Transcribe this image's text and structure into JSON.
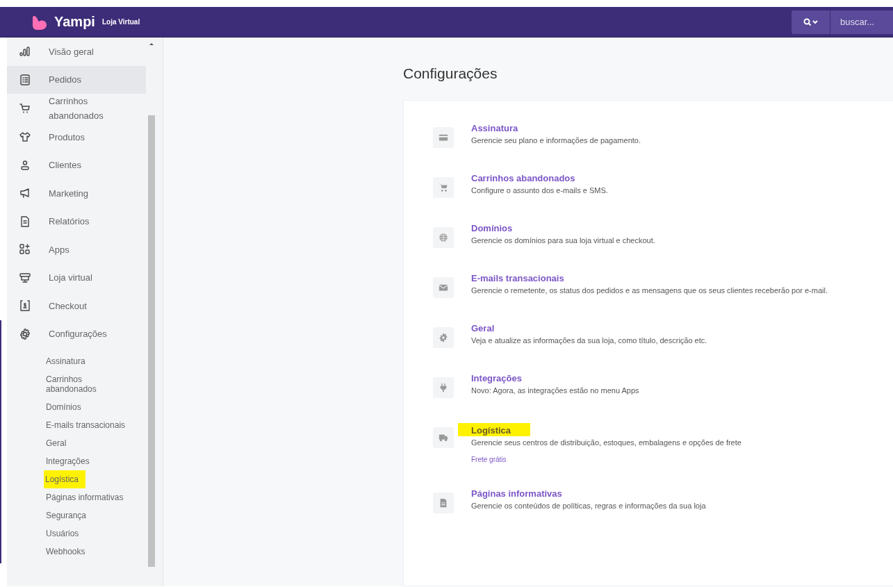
{
  "header": {
    "brand": "Yampi",
    "subtitle": "Loja Virtual",
    "search_placeholder": "buscar..."
  },
  "sidebar": {
    "items": [
      {
        "label": "Visão geral",
        "kind": "chart",
        "selected": false
      },
      {
        "label": "Pedidos",
        "kind": "list",
        "selected": true
      },
      {
        "label": "Carrinhos abandonados",
        "kind": "cart",
        "selected": false
      },
      {
        "label": "Produtos",
        "kind": "shirt",
        "selected": false
      },
      {
        "label": "Clientes",
        "kind": "user",
        "selected": false
      },
      {
        "label": "Marketing",
        "kind": "megaphone",
        "selected": false
      },
      {
        "label": "Relatórios",
        "kind": "doc",
        "selected": false
      },
      {
        "label": "Apps",
        "kind": "apps",
        "selected": false
      },
      {
        "label": "Loja virtual",
        "kind": "store",
        "selected": false
      },
      {
        "label": "Checkout",
        "kind": "dollar",
        "selected": false
      },
      {
        "label": "Configurações",
        "kind": "gear",
        "selected": false,
        "expanded": true,
        "children": [
          {
            "label": "Assinatura",
            "highlighted": false
          },
          {
            "label": "Carrinhos abandonados",
            "highlighted": false
          },
          {
            "label": "Domínios",
            "highlighted": false
          },
          {
            "label": "E-mails transacionais",
            "highlighted": false
          },
          {
            "label": "Geral",
            "highlighted": false
          },
          {
            "label": "Integrações",
            "highlighted": false
          },
          {
            "label": "Logística",
            "highlighted": true
          },
          {
            "label": "Páginas informativas",
            "highlighted": false
          },
          {
            "label": "Segurança",
            "highlighted": false
          },
          {
            "label": "Usuários",
            "highlighted": false
          },
          {
            "label": "Webhooks",
            "highlighted": false
          }
        ]
      }
    ]
  },
  "page": {
    "title": "Configurações",
    "settings": [
      {
        "kind": "card",
        "title": "Assinatura",
        "description": "Gerencie seu plano e informações de pagamento.",
        "highlighted": false
      },
      {
        "kind": "cart",
        "title": "Carrinhos abandonados",
        "description": "Configure o assunto dos e-mails e SMS.",
        "highlighted": false
      },
      {
        "kind": "globe",
        "title": "Domínios",
        "description": "Gerencie os domínios para sua loja virtual e checkout.",
        "highlighted": false
      },
      {
        "kind": "mail",
        "title": "E-mails transacionais",
        "description": "Gerencie o remetente, os status dos pedidos e as mensagens que os seus clientes receberão por e-mail.",
        "highlighted": false
      },
      {
        "kind": "gear",
        "title": "Geral",
        "description": "Veja e atualize as informações da sua loja, como título, descrição etc.",
        "highlighted": false
      },
      {
        "kind": "plug",
        "title": "Integrações",
        "description": "Novo: Agora, as integrações estão no menu Apps",
        "highlighted": false
      },
      {
        "kind": "truck",
        "title": "Logística",
        "description": "Gerencie seus centros de distribuição, estoques, embalagens e opções de frete",
        "highlighted": true,
        "link": "Frete grátis"
      },
      {
        "kind": "file",
        "title": "Páginas informativas",
        "description": "Gerencie os conteúdos de políticas, regras e informações da sua loja",
        "highlighted": false
      }
    ]
  }
}
